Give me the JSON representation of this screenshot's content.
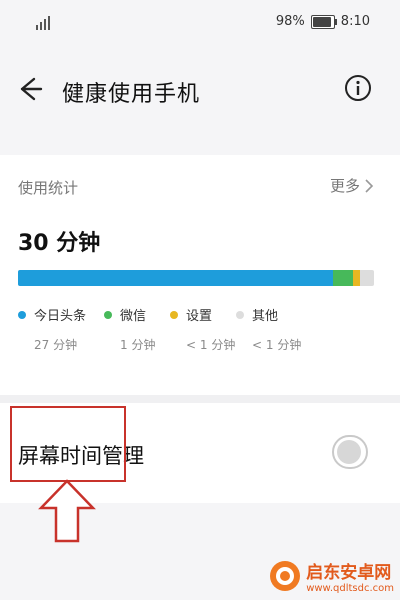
{
  "status_bar": {
    "battery_text": "98%",
    "battery_level": 0.98,
    "time": "8:10"
  },
  "header": {
    "title": "健康使用手机"
  },
  "usage": {
    "section_label": "使用统计",
    "more_label": "更多",
    "total": "30 分钟",
    "apps": [
      {
        "name": "今日头条",
        "duration": "27 分钟",
        "color": "#1e9ddb",
        "share": 0.886
      },
      {
        "name": "微信",
        "duration": "1 分钟",
        "color": "#47b95a",
        "share": 0.055
      },
      {
        "name": "设置",
        "duration": "< 1 分钟",
        "color": "#e7b722",
        "share": 0.02
      },
      {
        "name": "其他",
        "duration": "< 1 分钟",
        "color": "#dddddd",
        "share": 0.039
      }
    ]
  },
  "screen_time": {
    "label": "屏幕时间管理",
    "enabled": false
  },
  "watermark": {
    "title": "启东安卓网",
    "url": "www.qdltsdc.com"
  },
  "colors": {
    "annotation": "#c8322b",
    "background": "#f5f5f7"
  }
}
